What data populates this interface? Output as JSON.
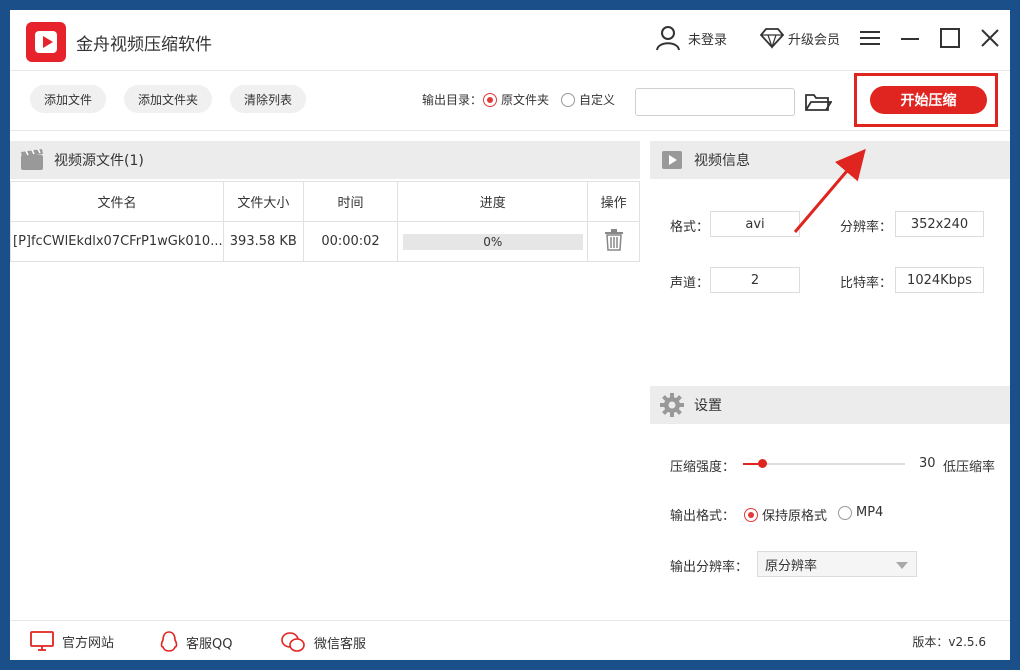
{
  "app": {
    "title": "金舟视频压缩软件"
  },
  "titlebar": {
    "login": "未登录",
    "vip": "升级会员"
  },
  "toolbar": {
    "add_file": "添加文件",
    "add_folder": "添加文件夹",
    "clear_list": "清除列表",
    "output_dir_label": "输出目录：",
    "opt_source": "原文件夹",
    "opt_custom": "自定义",
    "path_value": "",
    "start": "开始压缩"
  },
  "files": {
    "header": "视频源文件(1)",
    "columns": [
      "文件名",
      "文件大小",
      "时间",
      "进度",
      "操作"
    ],
    "rows": [
      {
        "name": "[P]fcCWlEkdlx07CFrP1wGk010...",
        "size": "393.58 KB",
        "time": "00:00:02",
        "progress_text": "0%",
        "progress": 0
      }
    ]
  },
  "video_info": {
    "header": "视频信息",
    "format_label": "格式：",
    "format": "avi",
    "resolution_label": "分辨率：",
    "resolution": "352x240",
    "channels_label": "声道：",
    "channels": "2",
    "bitrate_label": "比特率：",
    "bitrate": "1024Kbps"
  },
  "settings": {
    "header": "设置",
    "strength_label": "压缩强度：",
    "strength_value": "30",
    "strength_level": 0.3,
    "strength_desc": "低压缩率",
    "out_format_label": "输出格式：",
    "out_format_keep": "保持原格式",
    "out_format_mp4": "MP4",
    "out_res_label": "输出分辨率：",
    "out_res_value": "原分辨率"
  },
  "footer": {
    "website": "官方网站",
    "qq": "客服QQ",
    "wechat": "微信客服",
    "version": "版本：v2.5.6"
  },
  "colors": {
    "accent": "#e0241f",
    "panel_header": "#ececec"
  }
}
